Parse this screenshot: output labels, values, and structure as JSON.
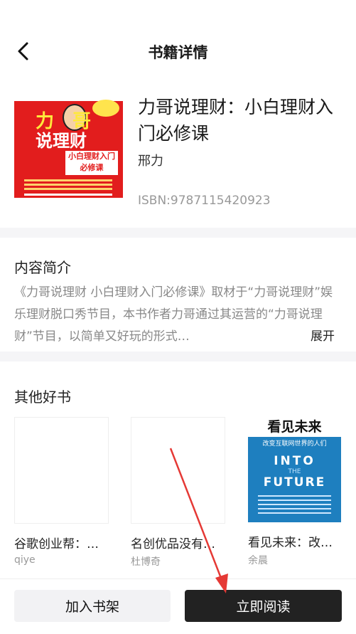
{
  "header": {
    "title": "书籍详情",
    "back_icon": "chevron-left-icon"
  },
  "book": {
    "title": "力哥说理财：小白理财入门必修课",
    "author": "邢力",
    "isbn": "ISBN:9787115420923",
    "cover": {
      "title_char1": "力",
      "title_char2": "哥",
      "title_line2": "说理财",
      "subtitle": "小白理财入门必修课"
    }
  },
  "intro": {
    "section_title": "内容简介",
    "text": "《力哥说理财 小白理财入门必修课》取材于“力哥说理财”娱乐理财脱口秀节目，本书作者力哥通过其运营的“力哥说理财”节目，以简单又好玩的形式…",
    "expand_label": "展开"
  },
  "recommendations": {
    "section_title": "其他好书",
    "items": [
      {
        "title": "谷歌创业帮：…",
        "author": "qiye"
      },
      {
        "title": "名创优品没有…",
        "author": "杜博奇"
      },
      {
        "title": "看见未来：改…",
        "author": "余晨",
        "cover": {
          "title": "看见未来",
          "subtitle": "改变互联网世界的人们",
          "into": "INTO",
          "the": "THE",
          "future": "FUTURE"
        }
      }
    ]
  },
  "bottom": {
    "add_shelf_label": "加入书架",
    "read_now_label": "立即阅读"
  },
  "colors": {
    "primary_button": "#222222",
    "secondary_button": "#f2f2f4",
    "annotation_arrow": "#e53935"
  }
}
